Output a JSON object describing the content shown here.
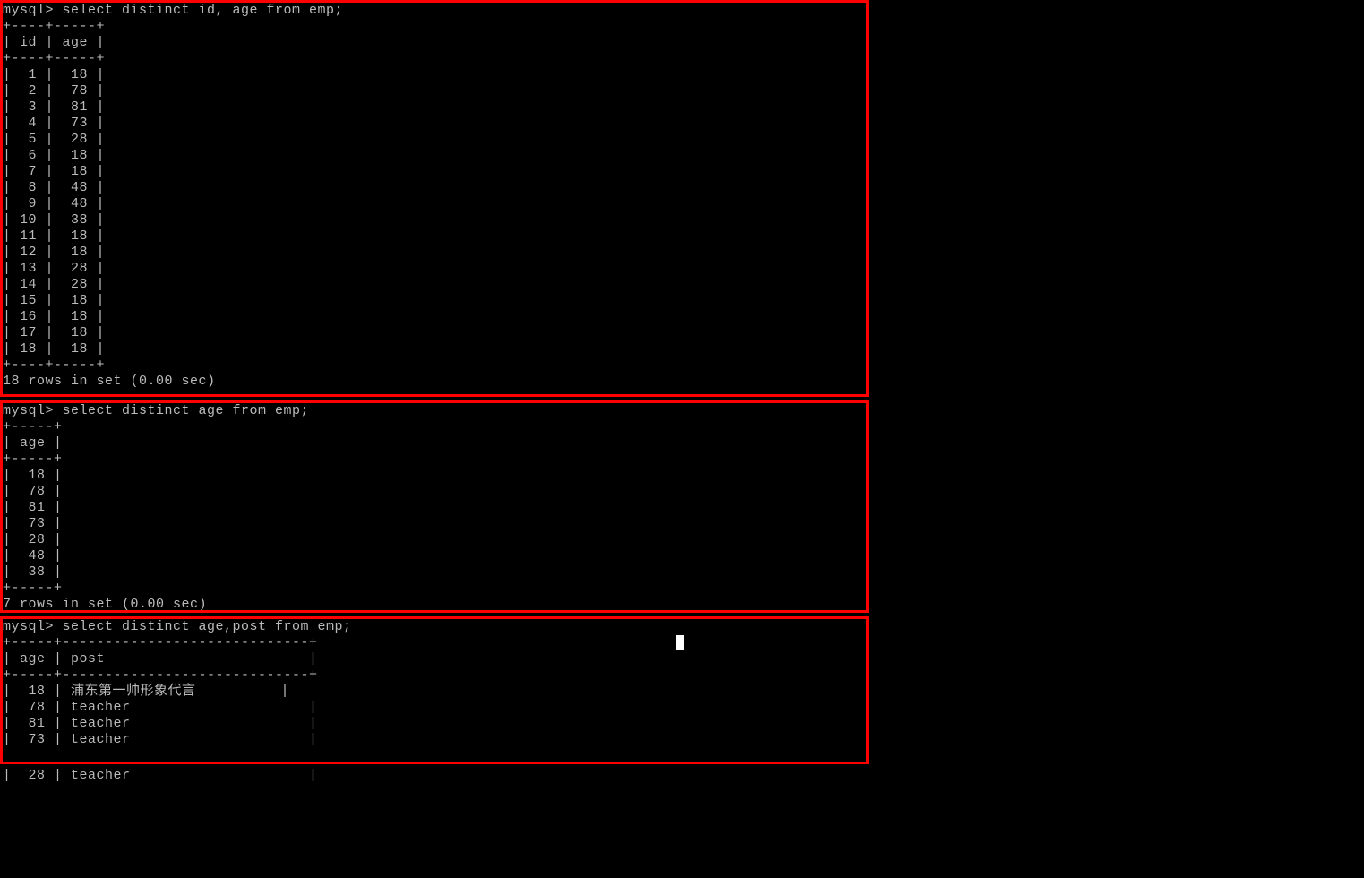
{
  "prompt": "mysql>",
  "block1": {
    "query": "select distinct id, age from emp;",
    "border_top": "+----+-----+",
    "header": "| id | age |",
    "rows": [
      {
        "id": "1",
        "age": "18"
      },
      {
        "id": "2",
        "age": "78"
      },
      {
        "id": "3",
        "age": "81"
      },
      {
        "id": "4",
        "age": "73"
      },
      {
        "id": "5",
        "age": "28"
      },
      {
        "id": "6",
        "age": "18"
      },
      {
        "id": "7",
        "age": "18"
      },
      {
        "id": "8",
        "age": "48"
      },
      {
        "id": "9",
        "age": "48"
      },
      {
        "id": "10",
        "age": "38"
      },
      {
        "id": "11",
        "age": "18"
      },
      {
        "id": "12",
        "age": "18"
      },
      {
        "id": "13",
        "age": "28"
      },
      {
        "id": "14",
        "age": "28"
      },
      {
        "id": "15",
        "age": "18"
      },
      {
        "id": "16",
        "age": "18"
      },
      {
        "id": "17",
        "age": "18"
      },
      {
        "id": "18",
        "age": "18"
      }
    ],
    "footer": "18 rows in set (0.00 sec)"
  },
  "block2": {
    "query": "select distinct age from emp;",
    "border_top": "+-----+",
    "header": "| age |",
    "rows": [
      {
        "age": "18"
      },
      {
        "age": "78"
      },
      {
        "age": "81"
      },
      {
        "age": "73"
      },
      {
        "age": "28"
      },
      {
        "age": "48"
      },
      {
        "age": "38"
      }
    ],
    "footer": "7 rows in set (0.00 sec)"
  },
  "block3": {
    "query": "select distinct age,post from emp;",
    "border_top": "+-----+-----------------------------+",
    "header": "| age | post                        |",
    "rows": [
      {
        "age": "18",
        "post": "浦东第一帅形象代言"
      },
      {
        "age": "78",
        "post": "teacher"
      },
      {
        "age": "81",
        "post": "teacher"
      },
      {
        "age": "73",
        "post": "teacher"
      },
      {
        "age": "28",
        "post": "teacher"
      }
    ]
  }
}
